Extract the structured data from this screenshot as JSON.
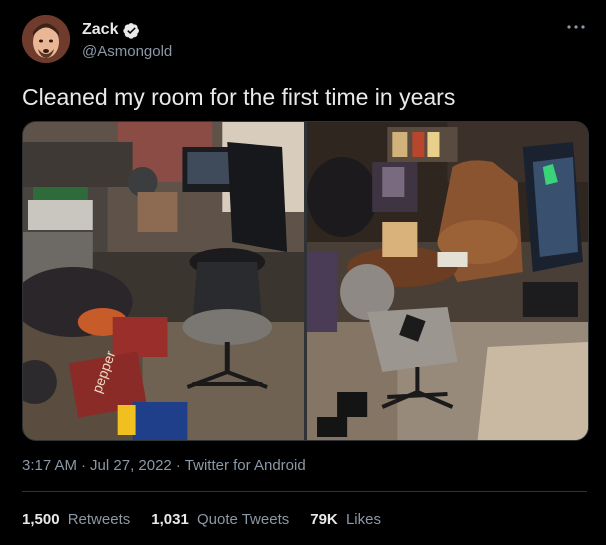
{
  "author": {
    "name": "Zack",
    "handle": "@Asmongold",
    "verified": true
  },
  "icons": {
    "verified": "verified-badge-icon",
    "more": "more-dots-icon"
  },
  "tweet": {
    "text": "Cleaned my room for the first time in years",
    "time": "3:17 AM",
    "date": "Jul 27, 2022",
    "source": "Twitter for Android",
    "separator": "·"
  },
  "stats": {
    "retweets": {
      "count": "1,500",
      "label": "Retweets"
    },
    "quotes": {
      "count": "1,031",
      "label": "Quote Tweets"
    },
    "likes": {
      "count": "79K",
      "label": "Likes"
    }
  },
  "colors": {
    "background": "#000000",
    "text": "#e7e9ea",
    "secondary": "#8b98a5",
    "verified": "#1d9bf0",
    "divider": "#2f3336"
  }
}
